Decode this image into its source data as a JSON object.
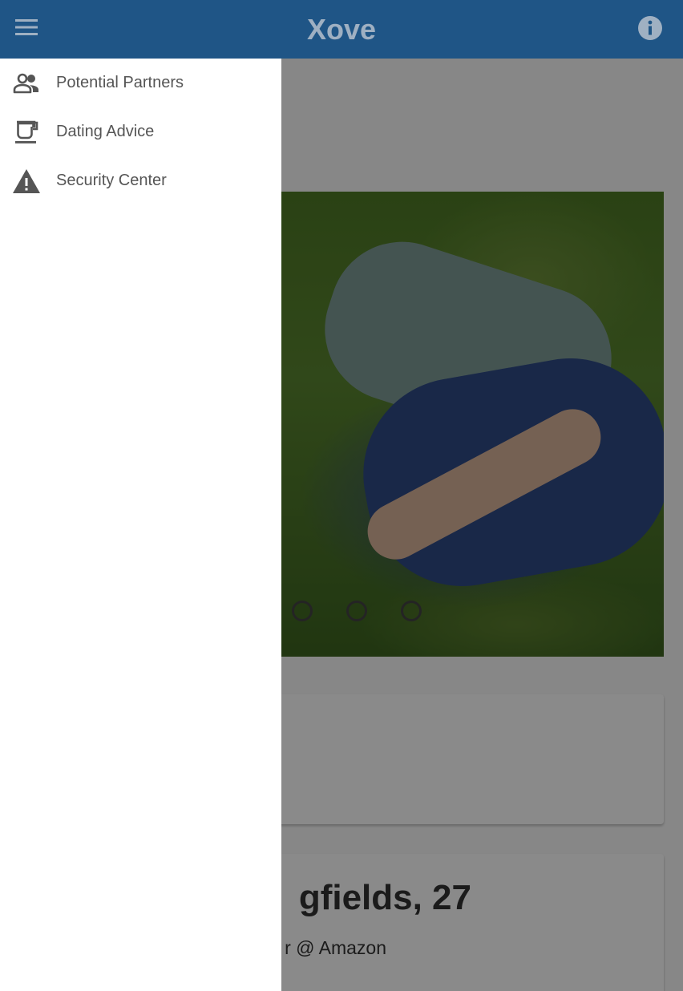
{
  "header": {
    "title": "Xove",
    "menu_icon": "menu-icon",
    "info_icon": "info-icon",
    "background_color": "#1f5586"
  },
  "drawer": {
    "items": [
      {
        "label": "Potential Partners",
        "icon": "people-icon"
      },
      {
        "label": "Dating Advice",
        "icon": "coffee-cup-icon"
      },
      {
        "label": "Security Center",
        "icon": "warning-icon"
      }
    ]
  },
  "profile": {
    "name_visible": "gfields, 27",
    "job_visible": "r @ Amazon",
    "photo_indicator_count": 3
  },
  "colors": {
    "drawer_text": "#555555",
    "icon_color": "#555555",
    "scrim": "rgba(0,0,0,0.46)"
  }
}
